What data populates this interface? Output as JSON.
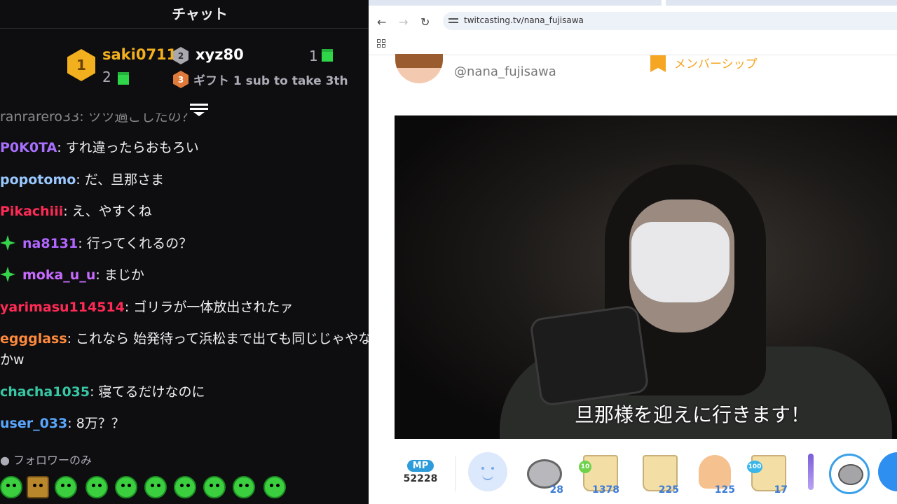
{
  "chat": {
    "title": "チャット",
    "leaderboard": {
      "first": {
        "rank": "1",
        "name": "saki0711",
        "count": "2"
      },
      "second": {
        "rank": "2",
        "name": "xyz80",
        "count": "1"
      },
      "third": {
        "rank": "3",
        "text": "ギフト 1 sub to take 3th"
      }
    },
    "partial_line": "ranrarero33: ツツ過ごしたの？",
    "messages": [
      {
        "user": "P0K0TA",
        "text": ": すれ違ったらおもろい",
        "color": "#a970ff",
        "star": false
      },
      {
        "user": "popotomo",
        "text": ": だ、旦那さま",
        "color": "#9ac8ff",
        "star": false
      },
      {
        "user": "Pikachiii",
        "text": ": え、やすくね",
        "color": "#ff2a55",
        "star": false
      },
      {
        "user": "na8131",
        "text": ": 行ってくれるの？",
        "color": "#b266ff",
        "star": true
      },
      {
        "user": "moka_u_u",
        "text": ": まじか",
        "color": "#c76bff",
        "star": true
      },
      {
        "user": "yarimasu114514",
        "text": ": ゴリラが一体放出されたァ",
        "color": "#ff2a55",
        "star": false
      },
      {
        "user": "eggglass",
        "text": ": これなら 始発待って浜松まで出ても同じじゃやな",
        "color": "#ff8a3d",
        "star": false
      },
      {
        "user": "",
        "text": "かw",
        "color": "#efeff1",
        "star": false
      },
      {
        "user": "chacha1035",
        "text": ": 寝てるだけなのに",
        "color": "#37c7a5",
        "star": false
      },
      {
        "user": "user_033",
        "text": ": 8万？？",
        "color": "#5aa7ff",
        "star": false
      }
    ],
    "followers_only": "フォロワーのみ"
  },
  "browser": {
    "url": "twitcasting.tv/nana_fujisawa",
    "handle": "@nana_fujisawa",
    "membership": "メンバーシップ",
    "subtitle": "旦那様を迎えに行きます！",
    "mp_label": "MP",
    "mp_value": "52228",
    "items": [
      {
        "name": "coin",
        "count": "28"
      },
      {
        "name": "cup-10",
        "count": "1378",
        "level": "10"
      },
      {
        "name": "cup",
        "count": "225"
      },
      {
        "name": "clap",
        "count": "125"
      },
      {
        "name": "cup-100",
        "count": "17",
        "level": "100"
      }
    ]
  },
  "colors": {
    "accent": "#2f8ff0",
    "gift_green": "#2fd64a",
    "member_orange": "#f5a623"
  }
}
